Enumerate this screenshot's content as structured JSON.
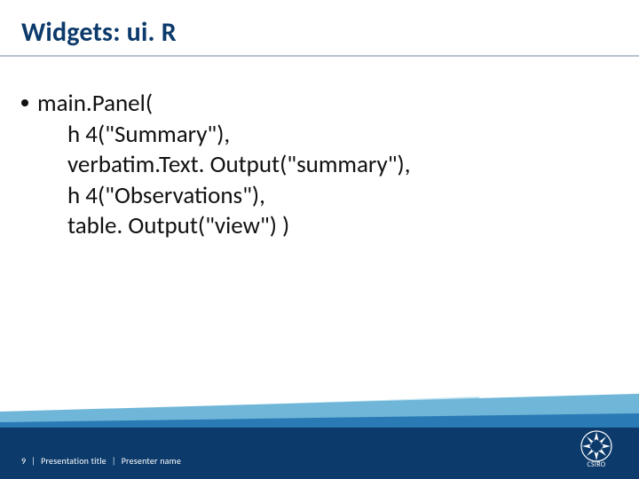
{
  "title": "Widgets: ui. R",
  "body": {
    "bullet_lead": "main.Panel(",
    "lines": [
      "h 4(\"Summary\"),",
      "verbatim.Text. Output(\"summary\"),",
      "h 4(\"Observations\"),",
      "table. Output(\"view\") )"
    ]
  },
  "footer": {
    "page_number": "9",
    "sep": "|",
    "presentation_title": "Presentation title",
    "presenter_name": "Presenter name"
  },
  "logo": {
    "name": "CSIRO"
  }
}
